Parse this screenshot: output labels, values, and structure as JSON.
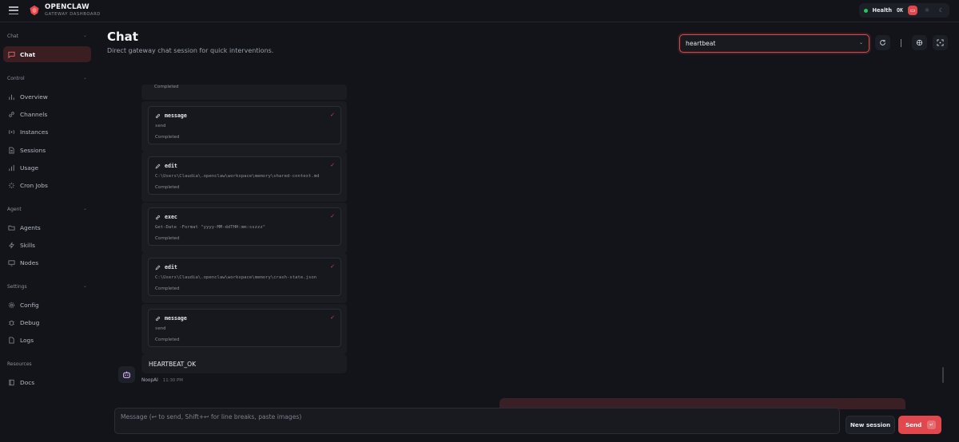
{
  "header": {
    "brand_name": "OPENCLAW",
    "brand_sub": "GATEWAY DASHBOARD",
    "health_label": "Health",
    "health_value": "OK",
    "accent": "#e0484d"
  },
  "sidebar": {
    "sections": [
      {
        "title": "Chat",
        "items": [
          {
            "label": "Chat",
            "icon": "message-square-icon",
            "active": true
          }
        ]
      },
      {
        "title": "Control",
        "items": [
          {
            "label": "Overview",
            "icon": "bar-chart-icon"
          },
          {
            "label": "Channels",
            "icon": "link-icon"
          },
          {
            "label": "Instances",
            "icon": "radio-icon"
          },
          {
            "label": "Sessions",
            "icon": "file-text-icon"
          },
          {
            "label": "Usage",
            "icon": "bar-chart-icon"
          },
          {
            "label": "Cron Jobs",
            "icon": "loader-icon"
          }
        ]
      },
      {
        "title": "Agent",
        "items": [
          {
            "label": "Agents",
            "icon": "folder-icon"
          },
          {
            "label": "Skills",
            "icon": "zap-icon"
          },
          {
            "label": "Nodes",
            "icon": "monitor-icon"
          }
        ]
      },
      {
        "title": "Settings",
        "items": [
          {
            "label": "Config",
            "icon": "gear-icon"
          },
          {
            "label": "Debug",
            "icon": "bug-icon"
          },
          {
            "label": "Logs",
            "icon": "file-icon"
          }
        ]
      },
      {
        "title": "Resources",
        "items": [
          {
            "label": "Docs",
            "icon": "book-icon"
          }
        ]
      }
    ]
  },
  "page": {
    "title": "Chat",
    "subtitle": "Direct gateway chat session for quick interventions.",
    "session_value": "heartbeat"
  },
  "thread": {
    "top_status": "Completed",
    "tool_cards": [
      {
        "tool": "message",
        "icon": "link-icon",
        "detail": "send",
        "status": "Completed"
      },
      {
        "tool": "edit",
        "icon": "pencil-icon",
        "detail": "C:\\Users\\Claudia\\.openclaw\\workspace\\memory\\shared-context.md",
        "status": "Completed"
      },
      {
        "tool": "exec",
        "icon": "link-icon",
        "detail": "Get-Date -Format \"yyyy-MM-ddTHH:mm:sszzz\"",
        "status": "Completed"
      },
      {
        "tool": "edit",
        "icon": "pencil-icon",
        "detail": "C:\\Users\\Claudia\\.openclaw\\workspace\\memory\\crash-state.json",
        "status": "Completed"
      },
      {
        "tool": "message",
        "icon": "link-icon",
        "detail": "send",
        "status": "Completed"
      }
    ],
    "final_text": "HEARTBEAT_OK",
    "sender": "NoopAI",
    "time": "11:30 PM"
  },
  "composer": {
    "placeholder": "Message (↩ to send, Shift+↩ for line breaks, paste images)",
    "new_session_label": "New session",
    "send_label": "Send",
    "send_kbd": "↵"
  }
}
